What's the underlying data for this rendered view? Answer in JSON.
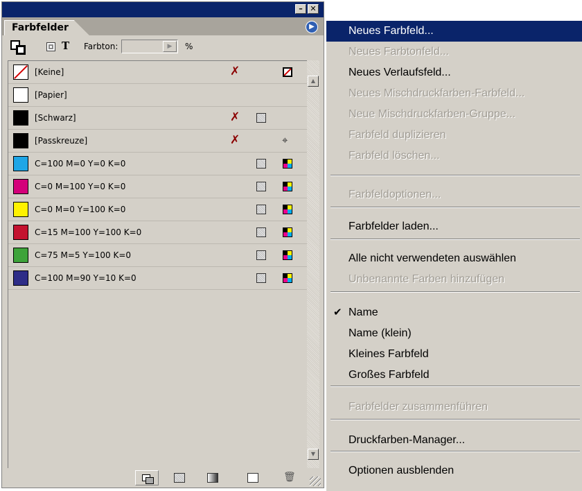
{
  "window": {
    "minimize_glyph": "–",
    "close_glyph": "✕"
  },
  "panel": {
    "tab_label": "Farbfelder",
    "tint_label": "Farbton:",
    "tint_value": "",
    "tint_unit": "%",
    "text_icon_glyph": "T"
  },
  "swatches": [
    {
      "name": "[Keine]",
      "color": "none",
      "edit_locked": true,
      "mode": "none"
    },
    {
      "name": "[Papier]",
      "color": "#ffffff",
      "edit_locked": false,
      "mode": ""
    },
    {
      "name": "[Schwarz]",
      "color": "#000000",
      "edit_locked": true,
      "mode": "cmyk"
    },
    {
      "name": "[Passkreuze]",
      "color": "#000000",
      "edit_locked": true,
      "mode": "registration"
    },
    {
      "name": "C=100 M=0 Y=0 K=0",
      "color": "#1fa6e6",
      "edit_locked": false,
      "mode": "process"
    },
    {
      "name": "C=0 M=100 Y=0 K=0",
      "color": "#d4007a",
      "edit_locked": false,
      "mode": "process"
    },
    {
      "name": "C=0 M=0 Y=100 K=0",
      "color": "#fff200",
      "edit_locked": false,
      "mode": "process"
    },
    {
      "name": "C=15 M=100 Y=100 K=0",
      "color": "#c4122f",
      "edit_locked": false,
      "mode": "process"
    },
    {
      "name": "C=75 M=5 Y=100 K=0",
      "color": "#3ea33a",
      "edit_locked": false,
      "mode": "process"
    },
    {
      "name": "C=100 M=90 Y=10 K=0",
      "color": "#2e2d87",
      "edit_locked": false,
      "mode": "process"
    }
  ],
  "menu": {
    "items": [
      {
        "label": "Neues Farbfeld...",
        "enabled": true,
        "highlighted": true
      },
      {
        "label": "Neues Farbtonfeld...",
        "enabled": false
      },
      {
        "label": "Neues Verlaufsfeld...",
        "enabled": true
      },
      {
        "label": "Neues Mischdruckfarben-Farbfeld...",
        "enabled": false
      },
      {
        "label": "Neue Mischdruckfarben-Gruppe...",
        "enabled": false
      },
      {
        "label": "Farbfeld duplizieren",
        "enabled": false
      },
      {
        "label": "Farbfeld löschen...",
        "enabled": false
      },
      {
        "label": "Farbfeldoptionen...",
        "enabled": false
      },
      {
        "label": "Farbfelder laden...",
        "enabled": true
      },
      {
        "label": "Alle nicht verwendeten auswählen",
        "enabled": true
      },
      {
        "label": "Unbenannte Farben hinzufügen",
        "enabled": false
      },
      {
        "label": "Name",
        "enabled": true,
        "checked": true
      },
      {
        "label": "Name (klein)",
        "enabled": true
      },
      {
        "label": "Kleines Farbfeld",
        "enabled": true
      },
      {
        "label": "Großes Farbfeld",
        "enabled": true
      },
      {
        "label": "Farbfelder zusammenführen",
        "enabled": false
      },
      {
        "label": "Druckfarben-Manager...",
        "enabled": true
      },
      {
        "label": "Optionen ausblenden",
        "enabled": true
      }
    ],
    "check_glyph": "✔"
  },
  "colors": {
    "titlebar": "#0a246a",
    "highlight": "#0a246a",
    "panel_bg": "#d4d0c8",
    "disabled_text": "#a09c94"
  }
}
